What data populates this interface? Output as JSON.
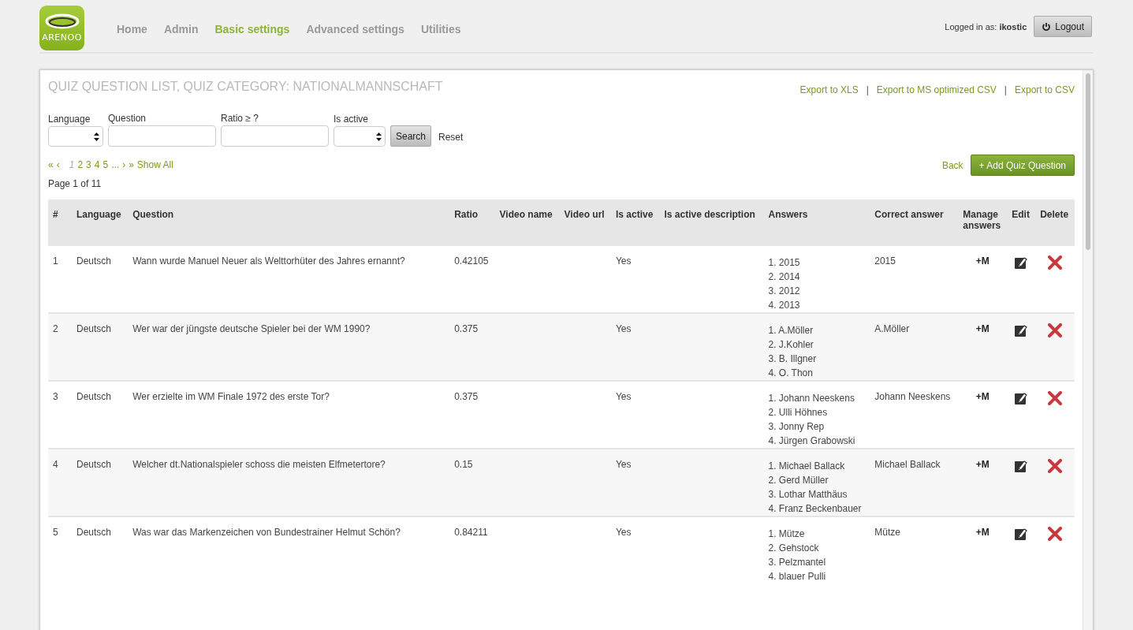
{
  "logo_text": "ARENOO",
  "nav": [
    {
      "label": "Home",
      "selected": false
    },
    {
      "label": "Admin",
      "selected": false
    },
    {
      "label": "Basic settings",
      "selected": true
    },
    {
      "label": "Advanced settings",
      "selected": false
    },
    {
      "label": "Utilities",
      "selected": false
    }
  ],
  "user": {
    "label": "Logged in as:",
    "name": "ikostic",
    "logout": "Logout"
  },
  "panel": {
    "title": "QUIZ QUESTION LIST, QUIZ CATEGORY: NATIONALMANNSCHAFT",
    "exports": [
      "Export to XLS",
      "Export to MS optimized CSV",
      "Export to CSV"
    ],
    "separator": "|",
    "filters": [
      {
        "label": "Language",
        "kind": "select"
      },
      {
        "label": "Question",
        "kind": "text"
      },
      {
        "label": "Ratio ≥ ?",
        "kind": "text"
      },
      {
        "label": "Is active",
        "kind": "select"
      }
    ],
    "search_button": "Search",
    "reset": "Reset",
    "pagination": {
      "first": "«",
      "prev": "‹",
      "pages": [
        {
          "label": "1",
          "selected": true
        },
        {
          "label": "2",
          "selected": false
        },
        {
          "label": "3",
          "selected": false
        },
        {
          "label": "4",
          "selected": false
        },
        {
          "label": "5",
          "selected": false
        }
      ],
      "ellipsis": "...",
      "next": "›",
      "last": "»",
      "show_all": "Show All"
    },
    "page_info": "Page 1 of 11",
    "back": "Back",
    "add_button": "+ Add Quiz Question"
  },
  "table": {
    "columns": [
      "#",
      "Language",
      "Question",
      "Ratio",
      "Video name",
      "Video url",
      "Is active",
      "Is active description",
      "Answers",
      "Correct answer",
      "Manage answers",
      "Edit",
      "Delete"
    ],
    "rows": [
      {
        "n": "1",
        "language": "Deutsch",
        "question": "Wann wurde Manuel Neuer als Welttorhüter des Jahres ernannt?",
        "ratio": "0.42105",
        "is_active": "Yes",
        "answers": [
          "1. 2015",
          "2. 2014",
          "3. 2012",
          "4. 2013"
        ],
        "correct": "2015",
        "manage": "+M"
      },
      {
        "n": "2",
        "language": "Deutsch",
        "question": "Wer war der jüngste deutsche Spieler bei der WM 1990?",
        "ratio": "0.375",
        "is_active": "Yes",
        "answers": [
          "1. A.Möller",
          "2. J.Kohler",
          "3. B. Illgner",
          "4. O. Thon"
        ],
        "correct": "A.Möller",
        "manage": "+M"
      },
      {
        "n": "3",
        "language": "Deutsch",
        "question": "Wer erzielte im WM Finale 1972 des erste Tor?",
        "ratio": "0.375",
        "is_active": "Yes",
        "answers": [
          "1. Johann Neeskens",
          "2. Ulli Höhnes",
          "3. Jonny Rep",
          "4. Jürgen Grabowski"
        ],
        "correct": "Johann Neeskens",
        "manage": "+M"
      },
      {
        "n": "4",
        "language": "Deutsch",
        "question": "Welcher dt.Nationalspieler schoss die meisten Elfmetertore?",
        "ratio": "0.15",
        "is_active": "Yes",
        "answers": [
          "1. Michael Ballack",
          "2. Gerd Müller",
          "3. Lothar Matthäus",
          "4. Franz Beckenbauer"
        ],
        "correct": "Michael Ballack",
        "manage": "+M"
      },
      {
        "n": "5",
        "language": "Deutsch",
        "question": "Was war das Markenzeichen von Bundestrainer Helmut Schön?",
        "ratio": "0.84211",
        "is_active": "Yes",
        "answers": [
          "1. Mütze",
          "2. Gehstock",
          "3. Pelzmantel",
          "4. blauer Pulli"
        ],
        "correct": "Mütze",
        "manage": "+M"
      }
    ]
  }
}
